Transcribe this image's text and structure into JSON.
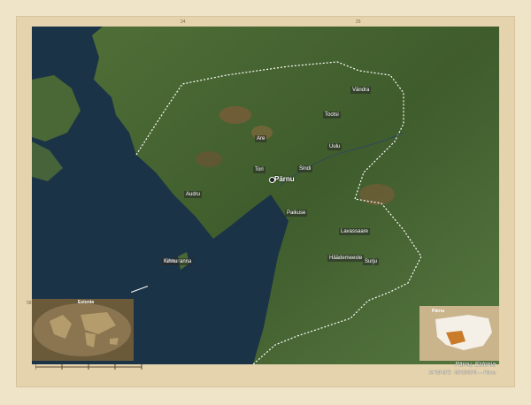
{
  "map": {
    "caption": "Pärnu, Estonia",
    "credits_coords": "24°29'48\"E  ·  58°23'08\"N",
    "credits_region": "Pärnu",
    "main_city": "Pärnu",
    "inset_world_title": "Estonia",
    "inset_region_title": "Pärnu",
    "lon_ticks": [
      "24",
      "25"
    ],
    "lat_ticks": [
      "58"
    ],
    "towns": [
      "Sindi",
      "Tahkuranna",
      "Paikuse",
      "Audru",
      "Vändra",
      "Tootsi",
      "Uulu",
      "Häädemeeste",
      "Kihnu",
      "Tori",
      "Are",
      "Surju",
      "Lavassaare"
    ],
    "colors": {
      "sea": "#1b3347",
      "land": "#4d6a35",
      "frame": "#e4d3ad",
      "border": "#ffffff"
    }
  }
}
